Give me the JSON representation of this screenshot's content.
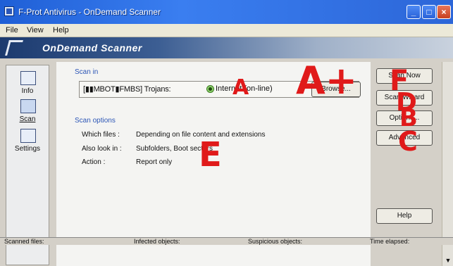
{
  "window": {
    "title": "F-Prot Antivirus - OnDemand Scanner"
  },
  "menu": {
    "items": [
      "File",
      "View",
      "Help"
    ]
  },
  "banner": {
    "title": "OnDemand Scanner"
  },
  "sidebar": {
    "items": [
      {
        "label": "Info",
        "icon": "info-icon"
      },
      {
        "label": "Scan",
        "icon": "scan-icon"
      },
      {
        "label": "Settings",
        "icon": "settings-icon"
      }
    ]
  },
  "scan_in": {
    "title": "Scan in",
    "value": "[▮▮MBOT▮FMBS] Trojans:",
    "radio_label": "Internet (on-line)",
    "browse_label": "Browse..."
  },
  "scan_options": {
    "title": "Scan options",
    "rows": [
      {
        "label": "Which files :",
        "value": "Depending on file content and extensions"
      },
      {
        "label": "Also look in :",
        "value": "Subfolders, Boot sectors"
      },
      {
        "label": "Action :",
        "value": "Report only"
      }
    ]
  },
  "buttons": {
    "scan_now": "Scan Now",
    "scan_wizard": "Scan Wizard",
    "options": "Options...",
    "advanced": "Advanced",
    "help": "Help"
  },
  "status": {
    "items": [
      "Scanned files:",
      "Infected objects:",
      "Suspicious objects:",
      "Time elapsed:"
    ]
  },
  "annotations": [
    "A",
    "A+",
    "F",
    "D",
    "B",
    "C",
    "E"
  ],
  "colors": {
    "titlebar": "#2c66d8",
    "accent_text": "#2b55b6",
    "annotation_red": "#e01a1a"
  }
}
